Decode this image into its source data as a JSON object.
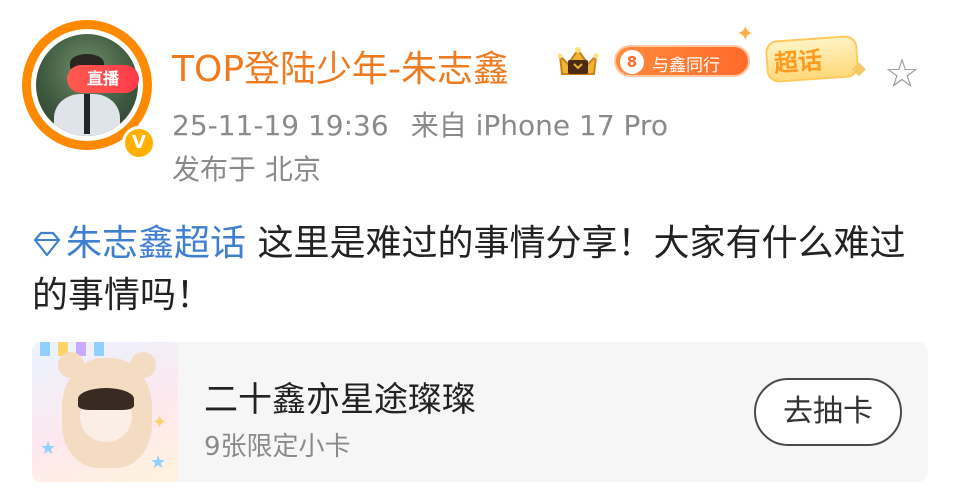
{
  "author": {
    "live_badge": "直播",
    "verify_badge": "V",
    "name": "TOP登陆少年-朱志鑫",
    "fan_badge_level": "8",
    "fan_badge_label": "与鑫同行",
    "chaohua_label": "超话"
  },
  "meta": {
    "time": "25-11-19 19:36",
    "source": "来自 iPhone 17 Pro",
    "location": "发布于 北京"
  },
  "content": {
    "topic": "朱志鑫超话",
    "text": " 这里是难过的事情分享！大家有什么难过的事情吗！"
  },
  "card": {
    "title": "二十鑫亦星途璨璨",
    "subtitle": "9张限定小卡",
    "button_label": "去抽卡"
  },
  "colors": {
    "username": "#f07a1e",
    "topic_link": "#3f7fd0",
    "meta_text": "#8a8a8a",
    "avatar_ring": "#ff8a00"
  },
  "icons": [
    "crown-icon",
    "star-icon",
    "diamond-icon",
    "sparkle-icon",
    "verified-icon"
  ]
}
